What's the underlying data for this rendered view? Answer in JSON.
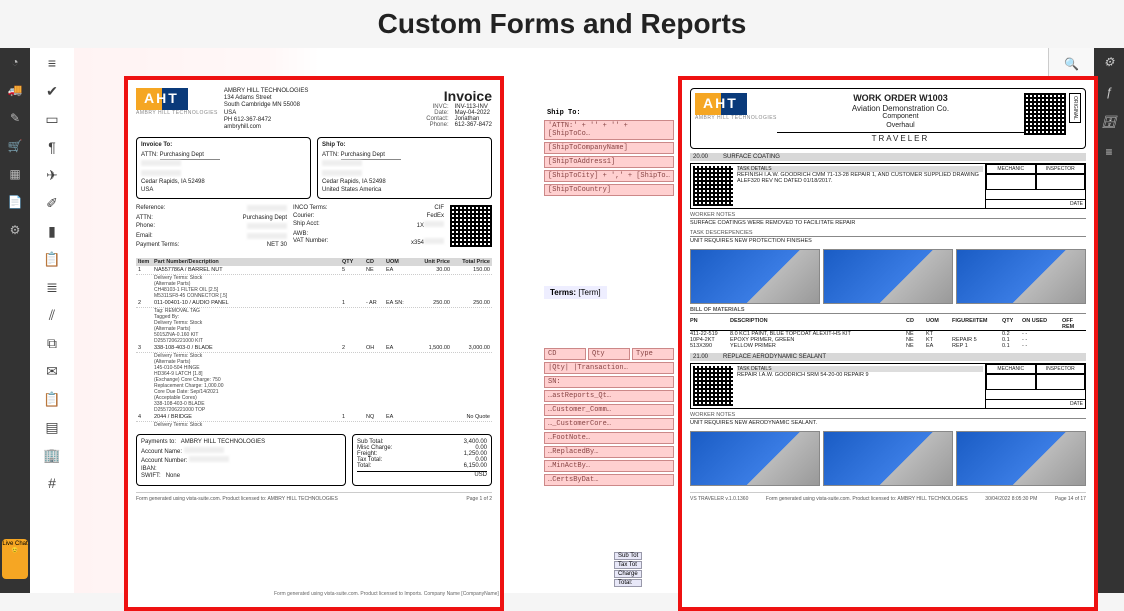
{
  "page_title": "Custom Forms and Reports",
  "left_rail": [
    "dashboard",
    "truck",
    "edit",
    "cart",
    "calendar",
    "file",
    "cog"
  ],
  "icon_col": [
    "menu",
    "check",
    "doc",
    "phone",
    "plane",
    "edit",
    "chart",
    "clipboard",
    "bars",
    "stats",
    "copy",
    "envelope",
    "paste",
    "cart2",
    "building",
    "hash"
  ],
  "right_rail": [
    "gear",
    "fx",
    "db",
    "stack"
  ],
  "right_panel": [
    "search",
    "grid",
    "rulers"
  ],
  "live_chat": "Live\nChat",
  "invoice": {
    "logo_sub": "AMBRY HILL TECHNOLOGIES",
    "company": {
      "name": "AMBRY HILL TECHNOLOGIES",
      "addr1": "134 Adams Street",
      "addr2": "South Cambridge MN 55008",
      "country": "USA",
      "ph": "PH 612-367-8472",
      "web": "ambryhill.com"
    },
    "title": "Invoice",
    "meta": {
      "INVC:": "INV-113-INV",
      "Date:": "May-04-2022",
      "Contact:": "Jonathan",
      "Phone:": "612-367-8472"
    },
    "invoice_to": {
      "hdr": "Invoice To:",
      "attn_label": "ATTN:",
      "attn": "Purchasing Dept",
      "city": "Cedar Rapids, IA 52498",
      "country": "USA"
    },
    "ship_to": {
      "hdr": "Ship To:",
      "attn_label": "ATTN:",
      "attn": "Purchasing Dept",
      "city": "Cedar Rapids, IA 52498",
      "country": "United States America"
    },
    "ref": {
      "Reference:": "",
      "ATTN:": "Purchasing Dept",
      "Phone:": "",
      "Email:": "",
      "Payment Terms:": "NET 30"
    },
    "ship_info": {
      "INCO Terms:": "CIF",
      "Courier:": "FedEx",
      "Ship Acct:": "1X",
      "AWB:": "",
      "VAT Number:": "x354"
    },
    "cols": [
      "Item",
      "Part Number/Description",
      "QTY",
      "CD",
      "UOM",
      "Unit Price",
      "Total Price"
    ],
    "lines": [
      {
        "n": "1",
        "pn": "NA557786A / BARREL NUT",
        "qty": "5",
        "cd": "NE",
        "uom": "EA",
        "unit": "30.00",
        "total": "150.00",
        "subs": [
          "Delivery Terms: Stock",
          "(Alternate Parts)",
          "CH48103-1      FILTER OIL [2.5]",
          "M5311SF8-45    CONNECTOR [.5]"
        ]
      },
      {
        "n": "2",
        "pn": "011-00401-10 / AUDIO PANEL",
        "qty": "1",
        "cd": "-\nAR",
        "uom": "EA\nSN:",
        "unit": "250.00",
        "total": "250.00",
        "subs": [
          "Tag: REMOVAL TAG",
          "Tagged By:",
          "Delivery Terms: Stock",
          "(Alternate Parts)",
          "5015ZNA-0.160   KIT",
          "D2557206221000  KIT"
        ]
      },
      {
        "n": "3",
        "pn": "338-108-403-0 / BLADE",
        "qty": "2",
        "cd": "OH",
        "uom": "EA",
        "unit": "1,500.00",
        "total": "3,000.00",
        "subs": [
          "Delivery Terms: Stock",
          "(Alternate Parts)",
          "145-010-504    HINGE",
          "HD364-9        LATCH [1.8]",
          "(Exchange)   Core Charge:   750",
          "         Replacement Charge:  1,000.00",
          "         Core Due Date:   Sep/14/2021",
          "(Acceptable Cores)",
          "338-108-403-0   BLADE",
          "D2557206221000  TOP"
        ]
      },
      {
        "n": "4",
        "pn": "2044 / BRIDGE",
        "qty": "1",
        "cd": "NQ",
        "uom": "EA",
        "unit": "",
        "total": "No Quote",
        "subs": [
          "Delivery Terms: Stock"
        ]
      }
    ],
    "payments_to": {
      "hdr": "Payments to:",
      "name": "AMBRY HILL TECHNOLOGIES",
      "acct_name_label": "Account Name:",
      "acct_num_label": "Account Number:",
      "iban_label": "IBAN:",
      "swift_label": "SWIFT:",
      "swift": "None"
    },
    "totals": {
      "Sub Total:": "3,400.00",
      "Misc Charge:": "0.00",
      "Freight:": "1,250.00",
      "Tax Total:": "0.00",
      "Total:": "6,150.00",
      "ccy": "USD"
    },
    "footer_left": "Form generated using vista-suite.com. Product licensed to: AMBRY HILL TECHNOLOGIES",
    "footer_right": "Page 1 of 2"
  },
  "traveler": {
    "logo_sub": "AMBRY HILL TECHNOLOGIES",
    "title1": "WORK ORDER W1003",
    "title2": "Aviation Demonstration Co.",
    "title3": "Component",
    "title4": "Overhaul",
    "bar_title": "TRAVELER",
    "original": "ORIGINAL",
    "sections": [
      {
        "n": "20.00",
        "name": "SURFACE COATING",
        "task_details_label": "TASK DETAILS",
        "task": "REFINISH I.A.W. GOODRICH CMM 71-13-28 REPAIR 1, AND CUSTOMER SUPPLIED DRAWING ALEF320 REV NC DATED 01/18/2017.",
        "mech": "MECHANIC",
        "insp": "INSPECTOR",
        "date": "DATE",
        "wn_label": "WORKER NOTES",
        "wn": "SURFACE COATINGS WERE REMOVED TO FACILITATE REPAIR",
        "td_label": "TASK DESCREPENCIES",
        "td": "UNIT REQUIRES NEW PROTECTION FINISHES"
      },
      {
        "n": "21.00",
        "name": "REPLACE AERODYNAMIC SEALANT",
        "task_details_label": "TASK DETAILS",
        "task": "REPAIR I.A.W. GOODRICH SRM 54-20-00 REPAIR 9",
        "mech": "MECHANIC",
        "insp": "INSPECTOR",
        "date": "DATE",
        "wn_label": "WORKER NOTES",
        "wn": "UNIT REQUIRES NEW AERODYNAMIC SEALANT."
      }
    ],
    "bom_label": "BILL OF MATERIALS",
    "bom_cols": [
      "PN",
      "DESCRIPTION",
      "CD",
      "UOM",
      "FIGURE/ITEM",
      "QTY",
      "ON USED",
      "OFF REM"
    ],
    "bom": [
      {
        "pn": "411-22-519",
        "d": "8.0 KC1 PAINT, BLUE TOPCOAT ALEXIT-HS KIT",
        "cd": "NE",
        "uom": "KT",
        "fig": "",
        "qty": "0.2",
        "rest": "-    -"
      },
      {
        "pn": "10P4-2KT",
        "d": "EPOXY PRIMER, GREEN",
        "cd": "NE",
        "uom": "KT",
        "fig": "REPAIR 5",
        "qty": "0.1",
        "rest": "-    -"
      },
      {
        "pn": "513X390",
        "d": "YELLOW PRIMER",
        "cd": "NE",
        "uom": "EA",
        "fig": "REP 1",
        "qty": "0.1",
        "rest": "-    -"
      }
    ],
    "footer_left": "Form generated using vista-suite.com. Product licensed to: AMBRY HILL TECHNOLOGIES",
    "footer_right": "Page 14 of 17",
    "footer_date": "30/04/2022 8:05:30 PM",
    "footer_code": "VS TRAVELER v.1.0.1360"
  },
  "placeholders1": [
    "'ATTN:' + '' + '' + [ShipToCo…",
    "[ShipToCompanyName]",
    "[ShipToAddress1]",
    "[ShipToCity] + ',' + [ShipTo…",
    "[ShipToCountry]"
  ],
  "placeholders1_label": "Ship To:",
  "placeholders2": [
    "CD",
    "Qty",
    "Type",
    "|Qty| |Transaction…",
    "SN:",
    "…astReports_Qt…",
    "…Customer_Comm…",
    "…_CustomerCore…",
    "…FootNote…",
    "…ReplacedBy…",
    "…MinActBy…",
    "…CertsByDat…"
  ],
  "terms_label": "Terms:",
  "terms_ph": "[Term]",
  "bottom_ph": [
    "Sub Tot",
    "Tax Tot",
    "Charge",
    "Total:"
  ],
  "bottom_footer": "Form generated using vista-suite.com. Product licensed to Imports. Company Name [CompanyName]"
}
